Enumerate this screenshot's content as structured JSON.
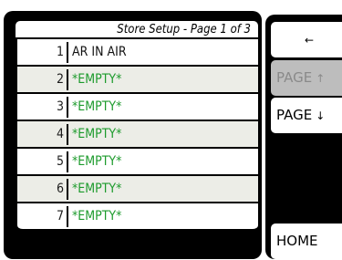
{
  "title": "Store Setup - Page 1 of 3",
  "rows": [
    {
      "number": "1",
      "label": "AR IN AIR",
      "empty": false
    },
    {
      "number": "2",
      "label": "*EMPTY*",
      "empty": true
    },
    {
      "number": "3",
      "label": "*EMPTY*",
      "empty": true
    },
    {
      "number": "4",
      "label": "*EMPTY*",
      "empty": true
    },
    {
      "number": "5",
      "label": "*EMPTY*",
      "empty": true
    },
    {
      "number": "6",
      "label": "*EMPTY*",
      "empty": true
    },
    {
      "number": "7",
      "label": "*EMPTY*",
      "empty": true
    }
  ],
  "buttons": {
    "back_glyph": "←",
    "back_icon": "back-arrow-icon",
    "page_up_label": "PAGE",
    "page_up_glyph": "↑",
    "page_up_icon": "arrow-up-icon",
    "page_up_enabled": false,
    "page_down_label": "PAGE",
    "page_down_glyph": "↓",
    "page_down_icon": "arrow-down-icon",
    "page_down_enabled": true,
    "home_label": "HOME"
  },
  "colors": {
    "empty_text": "#1b9a2b",
    "row_alt": "#ecede7",
    "disabled_button": "#bdbdbd"
  }
}
